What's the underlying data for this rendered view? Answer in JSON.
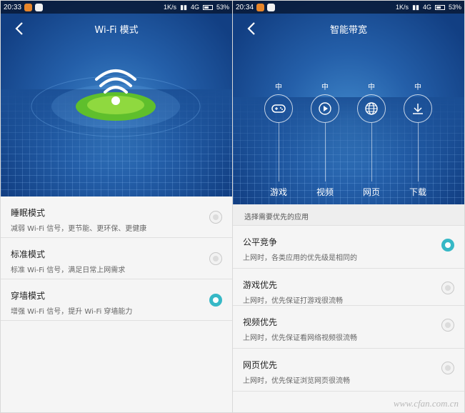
{
  "left": {
    "status": {
      "time": "20:33",
      "right_text": "1K/s",
      "network": "4G",
      "battery": "53%"
    },
    "title": "Wi-Fi 模式",
    "modes": [
      {
        "title": "睡眠模式",
        "desc": "减弱 Wi-Fi 信号，更节能、更环保、更健康",
        "selected": false
      },
      {
        "title": "标准模式",
        "desc": "标准 Wi-Fi 信号，满足日常上网需求",
        "selected": false
      },
      {
        "title": "穿墙模式",
        "desc": "增强 Wi-Fi 信号，提升 Wi-Fi 穿墙能力",
        "selected": true
      }
    ]
  },
  "right": {
    "status": {
      "time": "20:34",
      "right_text": "1K/s",
      "network": "4G",
      "battery": "53%"
    },
    "title": "智能带宽",
    "apps": [
      {
        "level": "中",
        "label": "游戏",
        "icon": "gamepad-icon"
      },
      {
        "level": "中",
        "label": "视频",
        "icon": "play-icon"
      },
      {
        "level": "中",
        "label": "网页",
        "icon": "globe-icon"
      },
      {
        "level": "中",
        "label": "下载",
        "icon": "download-icon"
      }
    ],
    "section_header": "选择需要优先的应用",
    "options": [
      {
        "title": "公平竞争",
        "desc": "上网时，各类应用的优先级是相同的",
        "selected": true
      },
      {
        "title": "游戏优先",
        "desc": "上网时，优先保证打游戏很流畅",
        "selected": false
      },
      {
        "title": "视频优先",
        "desc": "上网时，优先保证看网络视频很流畅",
        "selected": false
      },
      {
        "title": "网页优先",
        "desc": "上网时，优先保证浏览网页很流畅",
        "selected": false
      }
    ]
  },
  "watermark": "www.cfan.com.cn",
  "colors": {
    "accent": "#36b8c6",
    "hero": "#245fa9",
    "wifi_glow": "#7fd33a"
  }
}
